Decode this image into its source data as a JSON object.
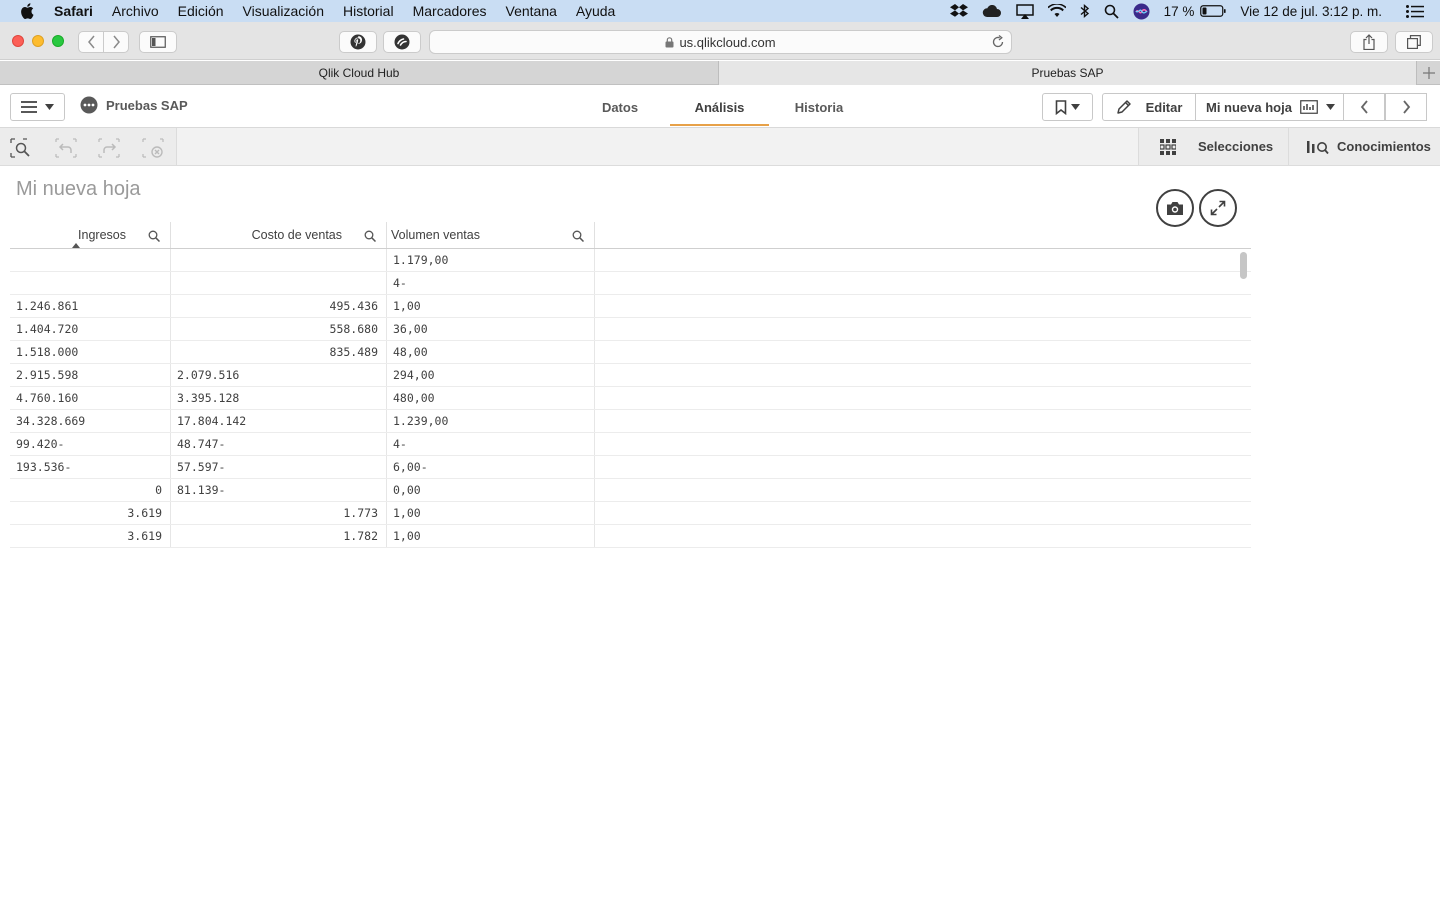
{
  "menubar": {
    "app": "Safari",
    "items": [
      "Archivo",
      "Edición",
      "Visualización",
      "Historial",
      "Marcadores",
      "Ventana",
      "Ayuda"
    ],
    "battery": "17 %",
    "datetime": "Vie 12 de jul.  3:12 p. m."
  },
  "browser": {
    "url": "us.qlikcloud.com",
    "tabs": [
      "Qlik Cloud Hub",
      "Pruebas SAP"
    ]
  },
  "qlik": {
    "app_name": "Pruebas SAP",
    "nav": [
      "Datos",
      "Análisis",
      "Historia"
    ],
    "active_nav": "Análisis",
    "edit_label": "Editar",
    "sheet_name": "Mi nueva hoja",
    "selections_label": "Selecciones",
    "insights_label": "Conocimientos"
  },
  "sheet": {
    "title": "Mi nueva hoja"
  },
  "table": {
    "columns": [
      "Ingresos",
      "Costo de ventas",
      "Volumen ventas"
    ],
    "rows": [
      {
        "c1": "",
        "c1_align": "r",
        "c2": "",
        "c2_align": "r",
        "c3": "1.179,00"
      },
      {
        "c1": "",
        "c1_align": "r",
        "c2": "",
        "c2_align": "r",
        "c3": "4-"
      },
      {
        "c1": "1.246.861",
        "c1_align": "l",
        "c2": "495.436",
        "c2_align": "r",
        "c3": "1,00"
      },
      {
        "c1": "1.404.720",
        "c1_align": "l",
        "c2": "558.680",
        "c2_align": "r",
        "c3": "36,00"
      },
      {
        "c1": "1.518.000",
        "c1_align": "l",
        "c2": "835.489",
        "c2_align": "r",
        "c3": "48,00"
      },
      {
        "c1": "2.915.598",
        "c1_align": "l",
        "c2": "2.079.516",
        "c2_align": "l",
        "c3": "294,00"
      },
      {
        "c1": "4.760.160",
        "c1_align": "l",
        "c2": "3.395.128",
        "c2_align": "l",
        "c3": "480,00"
      },
      {
        "c1": "34.328.669",
        "c1_align": "l",
        "c2": "17.804.142",
        "c2_align": "l",
        "c3": "1.239,00"
      },
      {
        "c1": "99.420-",
        "c1_align": "l",
        "c2": "48.747-",
        "c2_align": "l",
        "c3": "4-"
      },
      {
        "c1": "193.536-",
        "c1_align": "l",
        "c2": "57.597-",
        "c2_align": "l",
        "c3": "6,00-"
      },
      {
        "c1": "0",
        "c1_align": "r",
        "c2": "81.139-",
        "c2_align": "l",
        "c3": "0,00"
      },
      {
        "c1": "3.619",
        "c1_align": "r",
        "c2": "1.773",
        "c2_align": "r",
        "c3": "1,00"
      },
      {
        "c1": "3.619",
        "c1_align": "r",
        "c2": "1.782",
        "c2_align": "r",
        "c3": "1,00"
      }
    ]
  },
  "colors": {
    "accent_tab": "#e7a148",
    "menubar_bg": "#c9ddf3",
    "text": "#404040"
  }
}
